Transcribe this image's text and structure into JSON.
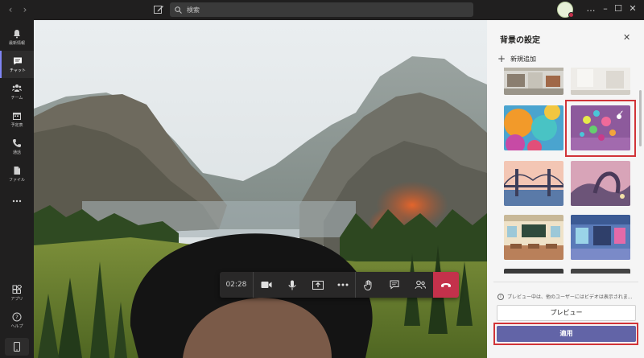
{
  "titlebar": {
    "back_icon": "chevron-left-icon",
    "forward_icon": "chevron-right-icon",
    "compose_icon": "compose-icon",
    "search_placeholder": "検索",
    "window_buttons": [
      "…",
      "–",
      "☐",
      "✕"
    ]
  },
  "rail": {
    "items": [
      {
        "label": "最新情報",
        "icon": "bell-icon",
        "active": false
      },
      {
        "label": "チャット",
        "icon": "chat-icon",
        "active": true
      },
      {
        "label": "チーム",
        "icon": "teams-icon",
        "active": false
      },
      {
        "label": "予定表",
        "icon": "calendar-icon",
        "active": false
      },
      {
        "label": "通話",
        "icon": "phone-icon",
        "active": false
      },
      {
        "label": "ファイル",
        "icon": "file-icon",
        "active": false
      },
      {
        "label": "",
        "icon": "more-icon",
        "active": false
      }
    ],
    "bottom": [
      {
        "label": "アプリ",
        "icon": "apps-icon"
      },
      {
        "label": "ヘルプ",
        "icon": "help-icon"
      }
    ]
  },
  "callbar": {
    "timer": "02:28"
  },
  "panel": {
    "title": "背景の設定",
    "add_new": "新規追加",
    "notice": "プレビュー中は、他のユーザーにはビデオは表示されま...",
    "preview_label": "プレビュー",
    "apply_label": "適用"
  },
  "colors": {
    "accent": "#6264a7",
    "hangup": "#c4314b",
    "highlight": "#d13438"
  }
}
